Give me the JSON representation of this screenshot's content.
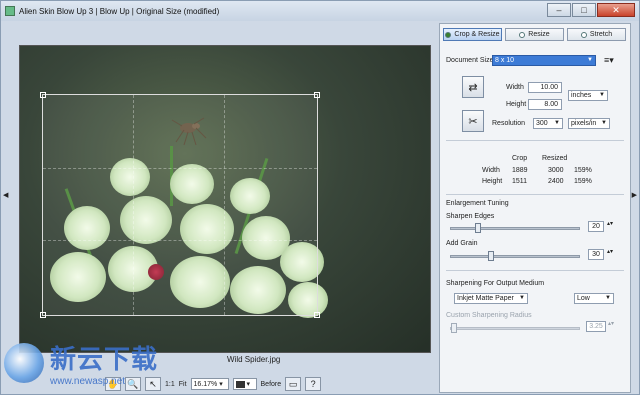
{
  "window": {
    "title": "Alien Skin Blow Up 3 | Blow Up | Original Size (modified)",
    "controls": {
      "minimize": "–",
      "maximize": "□",
      "close": "✕"
    }
  },
  "side_arrows": {
    "left": "◀",
    "right": "▶"
  },
  "canvas": {
    "filename": "Wild Spider.jpg"
  },
  "statusbar": {
    "zoom_prefix": "1:1",
    "fit_label": "Fit",
    "zoom_value": "16.17%",
    "before_label": "Before",
    "icons": [
      "hand-icon",
      "zoom-icon",
      "arrow-icon"
    ]
  },
  "panel": {
    "tabs": [
      {
        "label": "Crop & Resize",
        "active": true
      },
      {
        "label": "Resize",
        "active": false
      },
      {
        "label": "Stretch",
        "active": false
      }
    ],
    "document_size_label": "Document Size",
    "document_size_value": "8 x 10",
    "width_label": "Width",
    "width_value": "10.00",
    "height_label": "Height",
    "height_value": "8.00",
    "units_value": "inches",
    "resolution_label": "Resolution",
    "resolution_value": "300",
    "resolution_units": "pixels/in",
    "table": {
      "col_crop": "Crop",
      "col_resized": "Resized",
      "rows": [
        {
          "label": "Width",
          "crop": "1889",
          "resized": "3000",
          "pct": "159%"
        },
        {
          "label": "Height",
          "crop": "1511",
          "resized": "2400",
          "pct": "159%"
        }
      ]
    },
    "enlargement_label": "Enlargement Tuning",
    "sharpen_edges_label": "Sharpen Edges",
    "sharpen_edges_value": "20",
    "sharpen_edges_level": 0.2,
    "add_grain_label": "Add Grain",
    "add_grain_value": "30",
    "add_grain_level": 0.3,
    "output_label": "Sharpening For Output Medium",
    "output_medium_value": "Inkjet Matte Paper",
    "output_strength_value": "Low",
    "radius_label": "Custom Sharpening Radius",
    "radius_value": "3.25",
    "radius_level": 0.0
  },
  "watermark": {
    "cn": "新云下载",
    "url": "www.newasp.net"
  }
}
